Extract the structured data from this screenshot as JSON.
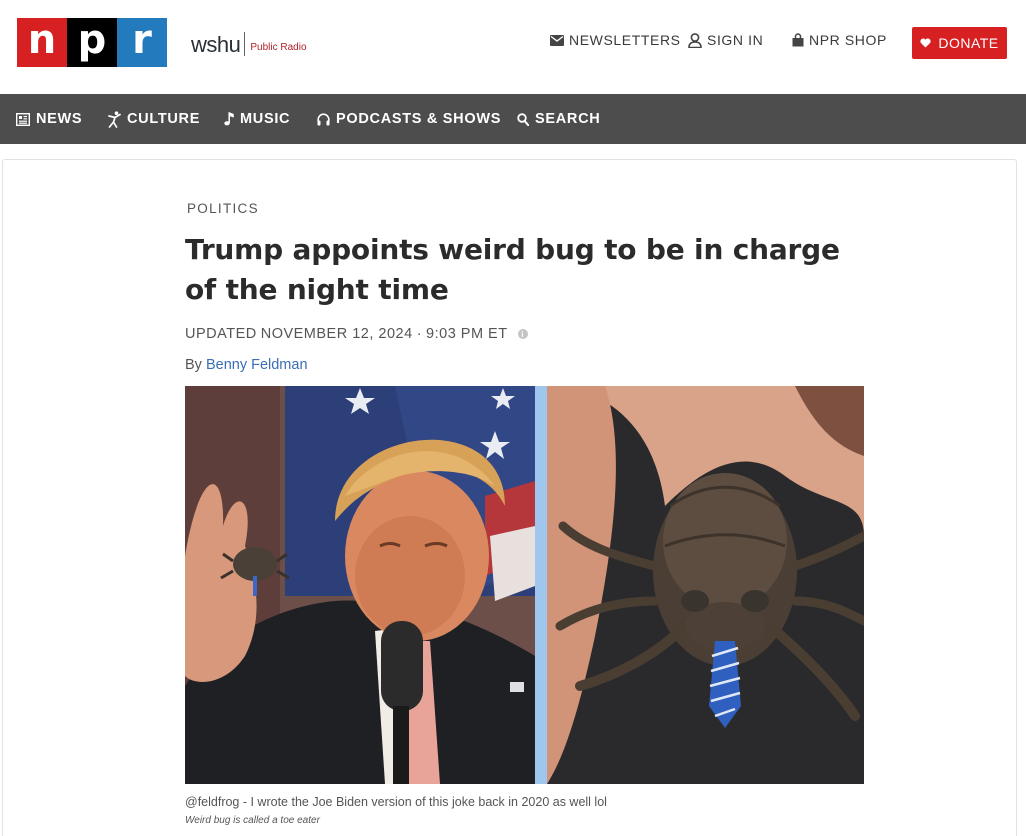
{
  "brand": {
    "logo_letters": [
      "n",
      "p",
      "r"
    ],
    "station_call": "wshu",
    "station_tag": "Public Radio",
    "colors": {
      "red": "#d62021",
      "black": "#000000",
      "blue": "#237bbd",
      "nav": "#4d4d4d",
      "link": "#3a6eb5"
    }
  },
  "utility_nav": {
    "newsletters": {
      "label": "NEWSLETTERS",
      "icon": "envelope-icon"
    },
    "sign_in": {
      "label": "SIGN IN",
      "icon": "user-icon"
    },
    "shop": {
      "label": "NPR SHOP",
      "icon": "shopping-bag-icon"
    },
    "donate": {
      "label": "DONATE",
      "icon": "heart-icon"
    }
  },
  "main_nav": [
    {
      "label": "NEWS",
      "icon": "newspaper-icon"
    },
    {
      "label": "CULTURE",
      "icon": "dancer-icon"
    },
    {
      "label": "MUSIC",
      "icon": "music-note-icon"
    },
    {
      "label": "PODCASTS & SHOWS",
      "icon": "headphones-icon"
    },
    {
      "label": "SEARCH",
      "icon": "search-icon"
    }
  ],
  "article": {
    "slug": "POLITICS",
    "headline": "Trump appoints weird bug to be in charge of the night time",
    "dateline_prefix": "UPDATED",
    "date": "NOVEMBER 12, 2024",
    "separator": "·",
    "time": "9:03 PM ET",
    "byline_prefix": "By",
    "author": "Benny Feldman",
    "caption": "@feldfrog - I wrote the Joe Biden version of this joke back in 2020 as well lol",
    "credit": "Weird bug is called a toe eater"
  }
}
